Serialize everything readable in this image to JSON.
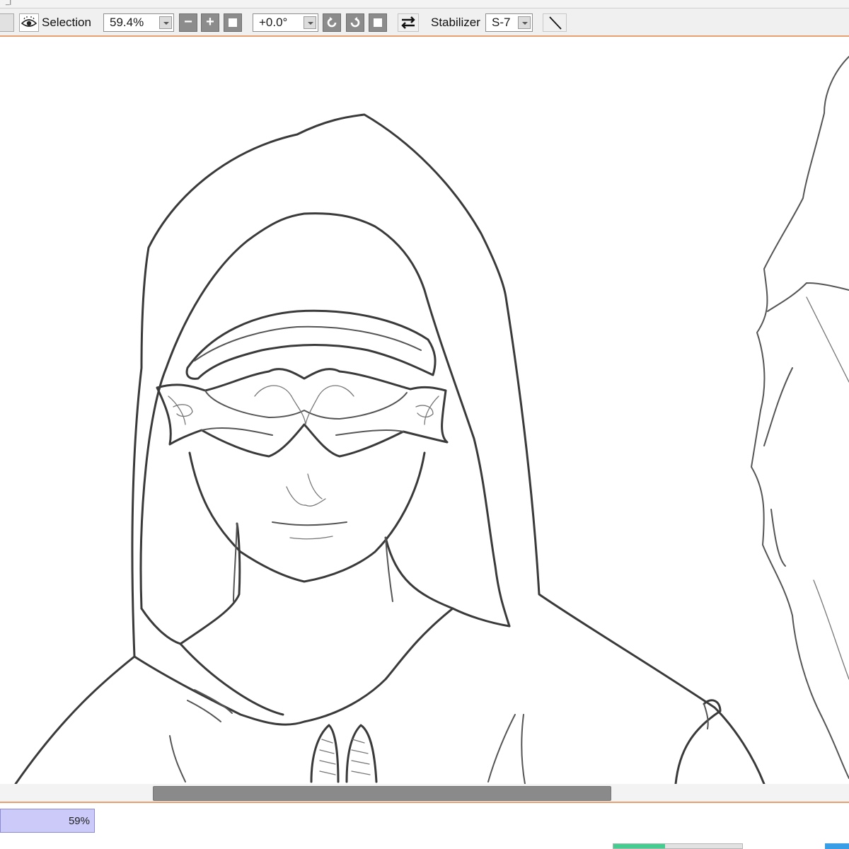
{
  "toolbar": {
    "selection_label": "Selection",
    "zoom_value": "59.4%",
    "rotation_value": "+0.0°",
    "stabilizer_label": "Stabilizer",
    "stabilizer_value": "S-7",
    "zoom_out_symbol": "−",
    "zoom_in_symbol": "+",
    "icons": {
      "view": "eye-icon",
      "zoom_reset": "square-reset-icon",
      "rotate_ccw": "rotate-left-icon",
      "rotate_cw": "rotate-right-icon",
      "rotation_reset": "square-reset-icon",
      "flip": "flip-horizontal-icon",
      "pen": "diagonal-line-icon"
    }
  },
  "navigator": {
    "zoom_percent_label": "59%"
  },
  "status": {
    "gauge_fraction": 0.4
  },
  "colors": {
    "accent_border": "#e8a070",
    "zoom_bar_fill": "#cbcaf8",
    "gauge_fill": "#3fcf8e",
    "corner_block": "#3a9ee6"
  }
}
